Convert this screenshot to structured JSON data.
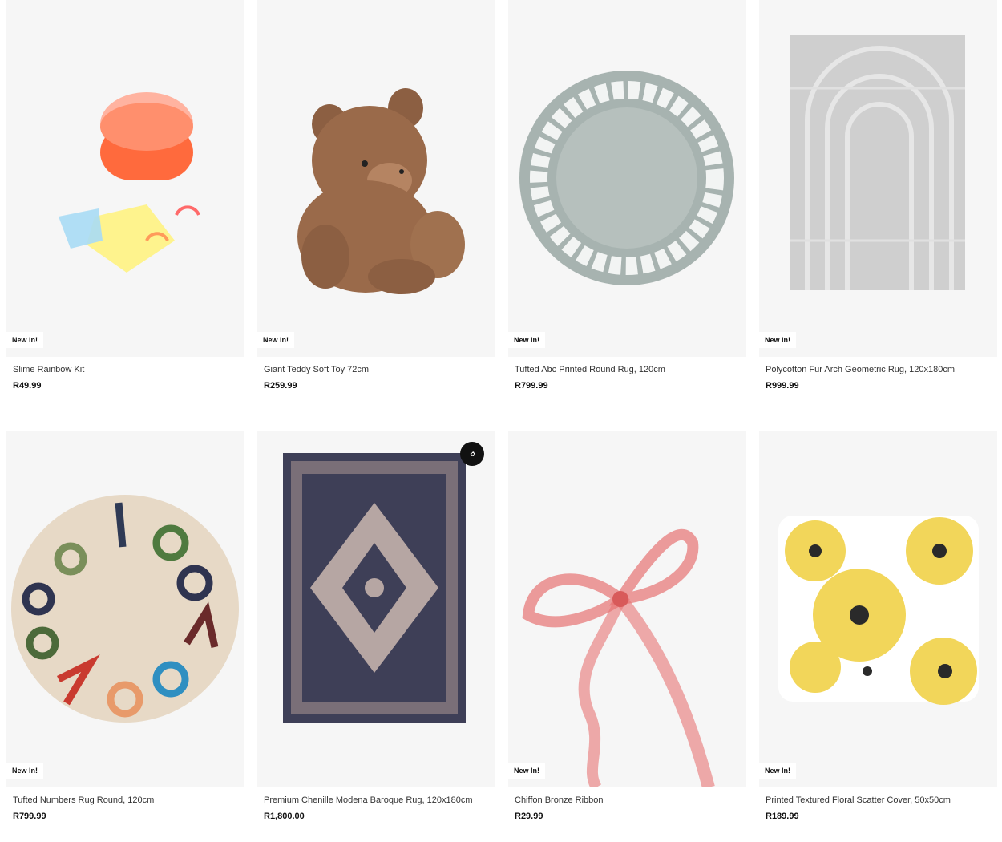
{
  "products": [
    {
      "name": "Slime Rainbow Kit",
      "price": "R49.99",
      "badge": "New In!",
      "icon": "slime-kit-image"
    },
    {
      "name": "Giant Teddy Soft Toy 72cm",
      "price": "R259.99",
      "badge": "New In!",
      "icon": "teddy-bear-image"
    },
    {
      "name": "Tufted Abc Printed Round Rug, 120cm",
      "price": "R799.99",
      "badge": "New In!",
      "icon": "abc-rug-image"
    },
    {
      "name": "Polycotton Fur Arch Geometric Rug, 120x180cm",
      "price": "R999.99",
      "badge": "New In!",
      "icon": "arch-rug-image"
    },
    {
      "name": "Tufted Numbers Rug Round, 120cm",
      "price": "R799.99",
      "badge": "New In!",
      "icon": "numbers-rug-image"
    },
    {
      "name": "Premium Chenille Modena Baroque Rug, 120x180cm",
      "price": "R1,800.00",
      "badge": "",
      "icon": "baroque-rug-image"
    },
    {
      "name": "Chiffon Bronze Ribbon",
      "price": "R29.99",
      "badge": "New In!",
      "icon": "ribbon-image"
    },
    {
      "name": "Printed Textured Floral Scatter Cover, 50x50cm",
      "price": "R189.99",
      "badge": "New In!",
      "icon": "floral-cushion-image"
    }
  ],
  "colors": {
    "tile_bg": "#f6f6f6",
    "slime": "#ff6a3d",
    "teddy": "#9a6a4a",
    "abc_rug": "#a7b3b0",
    "arch_rug": "#cfcfcf",
    "numbers_rug": "#e7d9c6",
    "baroque_rug": "#3e3f57",
    "ribbon": "#e77474",
    "floral": "#f2d65a"
  }
}
